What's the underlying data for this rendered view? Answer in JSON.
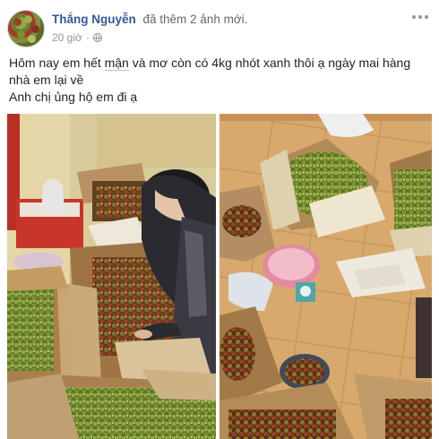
{
  "post": {
    "author": "Thắng Nguyễn",
    "action": "đã thêm 2 ảnh mới.",
    "timestamp": "20 giờ",
    "separator": "·",
    "privacy_icon": "globe-icon",
    "options_icon": "more-horizontal-icon",
    "text_line1_part1": "Hôm nay em hết ",
    "text_line1_highlight": "mận",
    "text_line1_part2": " và mơ còn có 4kg nhót xanh thôi ạ ngày mai hàng nhà em lại về",
    "text_line2": "Anh chị ủng hộ em đi ạ",
    "photo_count": 2
  },
  "colors": {
    "author_link": "#365899",
    "meta_text": "#90949c",
    "body_text": "#1d2129"
  }
}
